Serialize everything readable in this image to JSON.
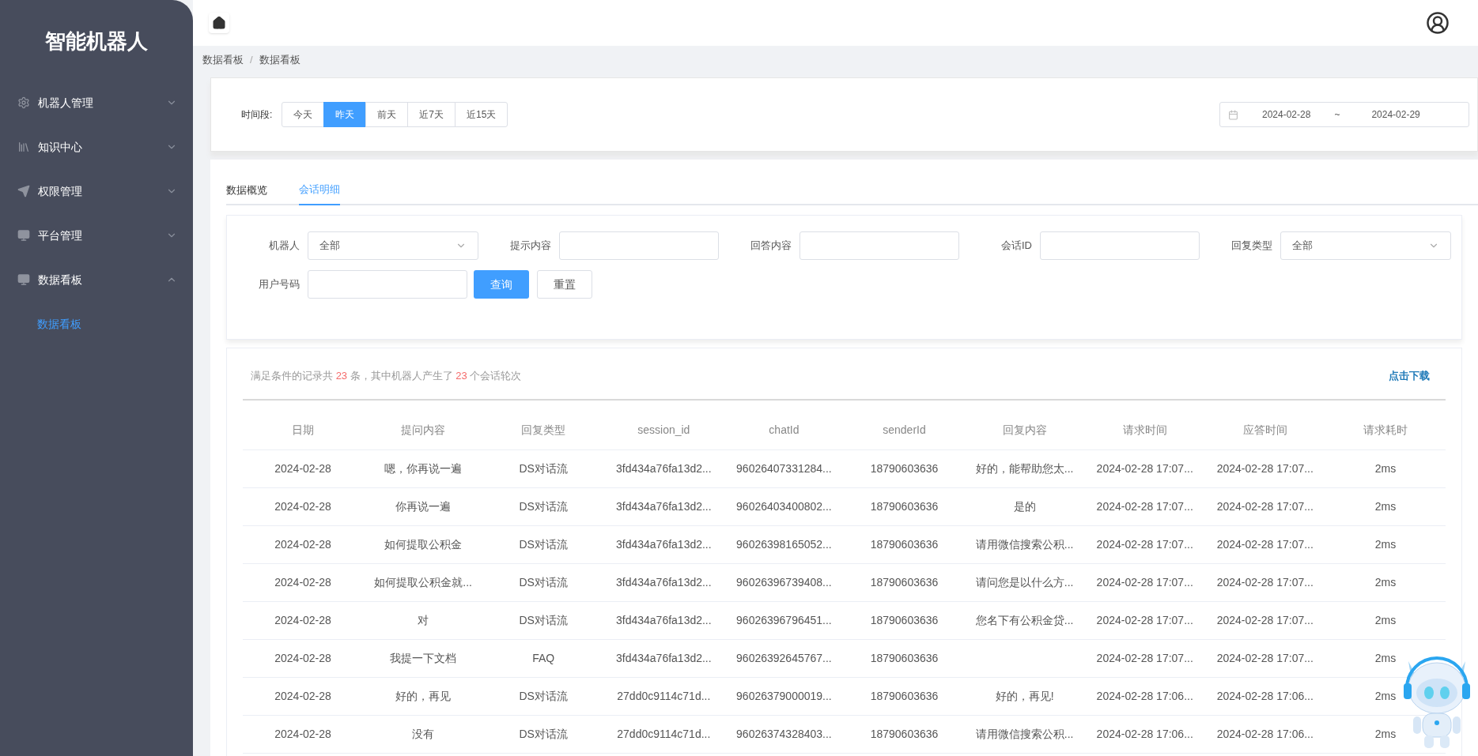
{
  "sidebar": {
    "title": "智能机器人",
    "items": [
      {
        "label": "机器人管理",
        "expanded": false
      },
      {
        "label": "知识中心",
        "expanded": false
      },
      {
        "label": "权限管理",
        "expanded": false
      },
      {
        "label": "平台管理",
        "expanded": false
      },
      {
        "label": "数据看板",
        "expanded": true,
        "children": [
          {
            "label": "数据看板",
            "selected": true
          }
        ]
      }
    ]
  },
  "breadcrumb": {
    "items": [
      "数据看板",
      "数据看板"
    ],
    "separator": "/"
  },
  "time_filter": {
    "label": "时间段:",
    "options": [
      {
        "label": "今天",
        "selected": false
      },
      {
        "label": "昨天",
        "selected": true
      },
      {
        "label": "前天",
        "selected": false
      },
      {
        "label": "近7天",
        "selected": false
      },
      {
        "label": "近15天",
        "selected": false
      }
    ]
  },
  "date_range": {
    "start": "2024-02-28",
    "separator": "~",
    "end": "2024-02-29"
  },
  "tabs": [
    {
      "label": "数据概览",
      "selected": false
    },
    {
      "label": "会话明细",
      "selected": true
    }
  ],
  "filters": [
    {
      "label": "机器人",
      "kind": "select",
      "value": "全部"
    },
    {
      "label": "提示内容",
      "kind": "input"
    },
    {
      "label": "回答内容",
      "kind": "input"
    },
    {
      "label": "会话ID",
      "kind": "input"
    },
    {
      "label": "回复类型",
      "kind": "select",
      "value": "全部"
    },
    {
      "label": "用户号码",
      "kind": "input"
    }
  ],
  "buttons": [
    {
      "label": "查询",
      "kind": "primary"
    },
    {
      "label": "重置",
      "kind": "default"
    }
  ],
  "summary": [
    {
      "text": "满足条件的记录共 ",
      "highlight": false
    },
    {
      "text": "23",
      "highlight": true
    },
    {
      "text": " 条，其中机器人产生了 ",
      "highlight": false
    },
    {
      "text": "23",
      "highlight": true
    },
    {
      "text": " 个会话轮次",
      "highlight": false
    }
  ],
  "download": "点击下载",
  "table": {
    "columns": [
      "日期",
      "提问内容",
      "回复类型",
      "session_id",
      "chatId",
      "senderId",
      "回复内容",
      "请求时间",
      "应答时间",
      "请求耗时"
    ],
    "rows": [
      [
        "2024-02-28",
        "嗯，你再说一遍",
        "DS对话流",
        "3fd434a76fa13d2...",
        "96026407331284...",
        "18790603636",
        "好的，能帮助您太...",
        "2024-02-28 17:07...",
        "2024-02-28 17:07...",
        "2ms"
      ],
      [
        "2024-02-28",
        "你再说一遍",
        "DS对话流",
        "3fd434a76fa13d2...",
        "96026403400802...",
        "18790603636",
        "是的",
        "2024-02-28 17:07...",
        "2024-02-28 17:07...",
        "2ms"
      ],
      [
        "2024-02-28",
        "如何提取公积金",
        "DS对话流",
        "3fd434a76fa13d2...",
        "96026398165052...",
        "18790603636",
        "请用微信搜索公积...",
        "2024-02-28 17:07...",
        "2024-02-28 17:07...",
        "2ms"
      ],
      [
        "2024-02-28",
        "如何提取公积金就...",
        "DS对话流",
        "3fd434a76fa13d2...",
        "96026396739408...",
        "18790603636",
        "请问您是以什么方...",
        "2024-02-28 17:07...",
        "2024-02-28 17:07...",
        "2ms"
      ],
      [
        "2024-02-28",
        "对",
        "DS对话流",
        "3fd434a76fa13d2...",
        "96026396796451...",
        "18790603636",
        "您名下有公积金贷...",
        "2024-02-28 17:07...",
        "2024-02-28 17:07...",
        "2ms"
      ],
      [
        "2024-02-28",
        "我提一下文档",
        "FAQ",
        "3fd434a76fa13d2...",
        "96026392645767...",
        "18790603636",
        "",
        "2024-02-28 17:07...",
        "2024-02-28 17:07...",
        "2ms"
      ],
      [
        "2024-02-28",
        "好的，再见",
        "DS对话流",
        "27dd0c9114c71d...",
        "96026379000019...",
        "18790603636",
        "好的，再见!",
        "2024-02-28 17:06...",
        "2024-02-28 17:06...",
        "2ms"
      ],
      [
        "2024-02-28",
        "没有",
        "DS对话流",
        "27dd0c9114c71d...",
        "96026374328403...",
        "18790603636",
        "请用微信搜索公积...",
        "2024-02-28 17:06...",
        "2024-02-28 17:06...",
        "2ms"
      ]
    ]
  }
}
